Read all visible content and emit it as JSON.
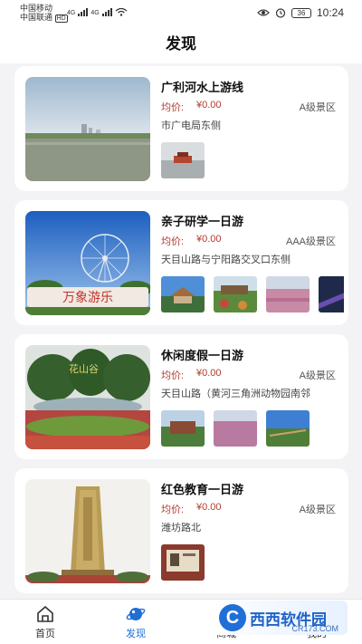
{
  "status_bar": {
    "carrier_1": "中国移动",
    "carrier_2": "中国联通",
    "carrier_2_badge": "HD",
    "network_1": "4G",
    "network_2": "4G",
    "battery": "36",
    "time": "10:24"
  },
  "header": {
    "title": "发现"
  },
  "routes": [
    {
      "title": "广利河水上游线",
      "price_label": "均价:",
      "price": "¥0.00",
      "level": "A级景区",
      "address": "市广电局东侧"
    },
    {
      "title": "亲子研学一日游",
      "price_label": "均价:",
      "price": "¥0.00",
      "level": "AAA级景区",
      "address": "天目山路与宁阳路交叉口东侧",
      "photo_sign": "万象游乐"
    },
    {
      "title": "休闲度假一日游",
      "price_label": "均价:",
      "price": "¥0.00",
      "level": "A级景区",
      "address": "天目山路（黄河三角洲动物园南邻",
      "photo_sign": "花山谷"
    },
    {
      "title": "红色教育一日游",
      "price_label": "均价:",
      "price": "¥0.00",
      "level": "A级景区",
      "address": "潍坊路北"
    }
  ],
  "tabbar": {
    "items": [
      {
        "label": "首页",
        "icon": "home-icon"
      },
      {
        "label": "发现",
        "icon": "planet-icon",
        "active": true
      },
      {
        "label": "商城",
        "icon": "shop-icon"
      },
      {
        "label": "我的",
        "icon": "user-icon"
      }
    ]
  },
  "watermark": {
    "text": "西西软件园",
    "url": "CR173.COM"
  },
  "colors": {
    "price": "#b23a2e",
    "accent": "#1f6fd6",
    "background": "#f3f3f5"
  }
}
